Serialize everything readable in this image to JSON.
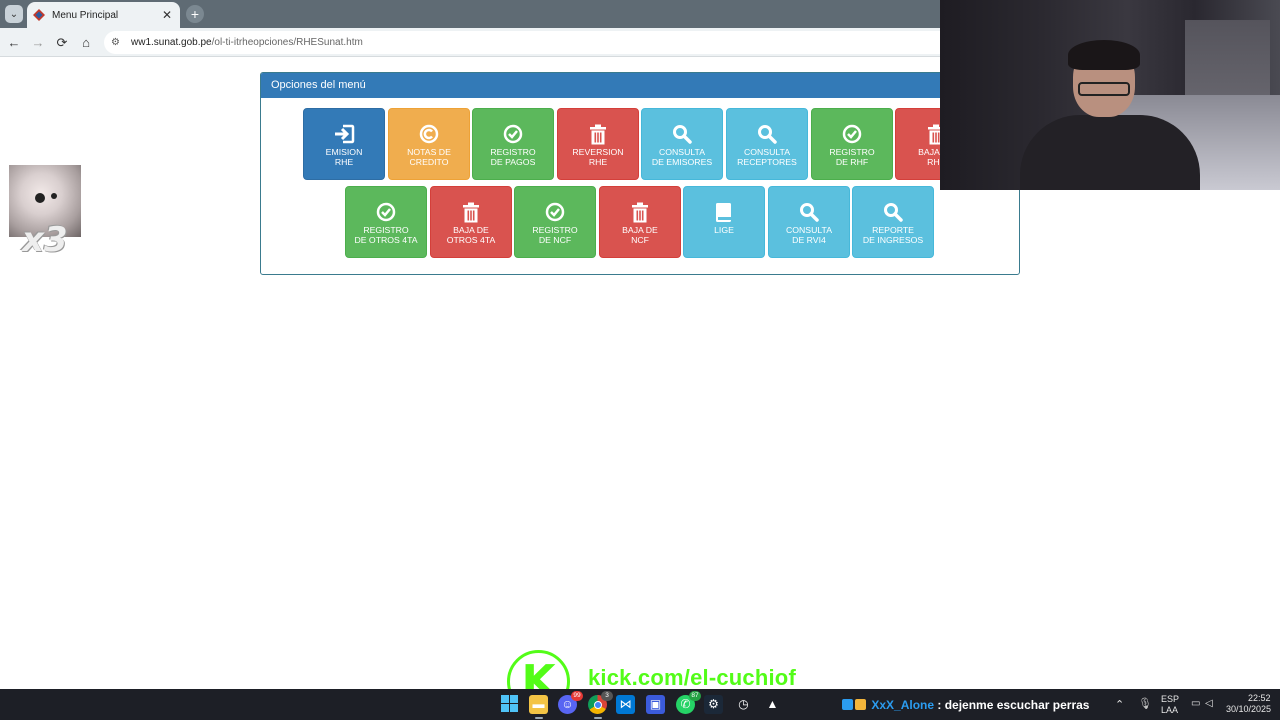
{
  "browser": {
    "tab_title": "Menu Principal",
    "tab_close": "✕",
    "new_tab": "+",
    "url_host": "ww1.sunat.gob.pe",
    "url_path": "/ol-ti-itrheopciones/RHESunat.htm",
    "nav": {
      "back": "←",
      "forward": "→",
      "reload": "⟳",
      "home": "⌂"
    }
  },
  "panel": {
    "title": "Opciones del menú",
    "tiles": [
      {
        "label_1": "EMISION",
        "label_2": "RHE",
        "color": "blue",
        "icon": "sign-in-icon"
      },
      {
        "label_1": "NOTAS DE",
        "label_2": "CREDITO",
        "color": "orange",
        "icon": "copyright-circle-icon"
      },
      {
        "label_1": "REGISTRO",
        "label_2": "DE PAGOS",
        "color": "green",
        "icon": "check-circle-icon"
      },
      {
        "label_1": "REVERSION",
        "label_2": "RHE",
        "color": "red",
        "icon": "trash-icon"
      },
      {
        "label_1": "CONSULTA",
        "label_2": "DE EMISORES",
        "color": "cyan",
        "icon": "search-icon"
      },
      {
        "label_1": "CONSULTA",
        "label_2": "RECEPTORES",
        "color": "cyan",
        "icon": "search-icon"
      },
      {
        "label_1": "REGISTRO",
        "label_2": "DE RHF",
        "color": "green",
        "icon": "check-circle-icon"
      },
      {
        "label_1": "BAJA DE",
        "label_2": "RHF",
        "color": "red",
        "icon": "trash-icon"
      },
      {
        "label_1": "REGISTRO",
        "label_2": "DE OTROS 4TA",
        "color": "green",
        "icon": "check-circle-icon"
      },
      {
        "label_1": "BAJA DE",
        "label_2": "OTROS 4TA",
        "color": "red",
        "icon": "trash-icon"
      },
      {
        "label_1": "REGISTRO",
        "label_2": "DE NCF",
        "color": "green",
        "icon": "check-circle-icon"
      },
      {
        "label_1": "BAJA DE",
        "label_2": "NCF",
        "color": "red",
        "icon": "trash-icon"
      },
      {
        "label_1": "LIGE",
        "label_2": "",
        "color": "cyan",
        "icon": "book-icon"
      },
      {
        "label_1": "CONSULTA",
        "label_2": "DE RVI4",
        "color": "cyan",
        "icon": "search-icon"
      },
      {
        "label_1": "REPORTE",
        "label_2": "DE INGRESOS",
        "color": "cyan",
        "icon": "search-icon"
      }
    ]
  },
  "overlay": {
    "multiplier": "x3",
    "kick_letter": "K",
    "kick_url": "kick.com/el-cuchiof",
    "chat_user": "XxX_Alone",
    "chat_sep": " : ",
    "chat_message": "dejenme escuchar perras"
  },
  "taskbar": {
    "badges": {
      "discord": "99",
      "chrome": "3",
      "whatsapp": "87"
    },
    "lang_1": "ESP",
    "lang_2": "LAA",
    "time": "22:52",
    "date": "30/10/2025"
  },
  "colors": {
    "blue": "#337ab7",
    "orange": "#f0ad4e",
    "green": "#5cb85c",
    "red": "#d9534f",
    "cyan": "#5bc0de",
    "kick_green": "#53fc18",
    "chat_user": "#2b9cf0"
  }
}
